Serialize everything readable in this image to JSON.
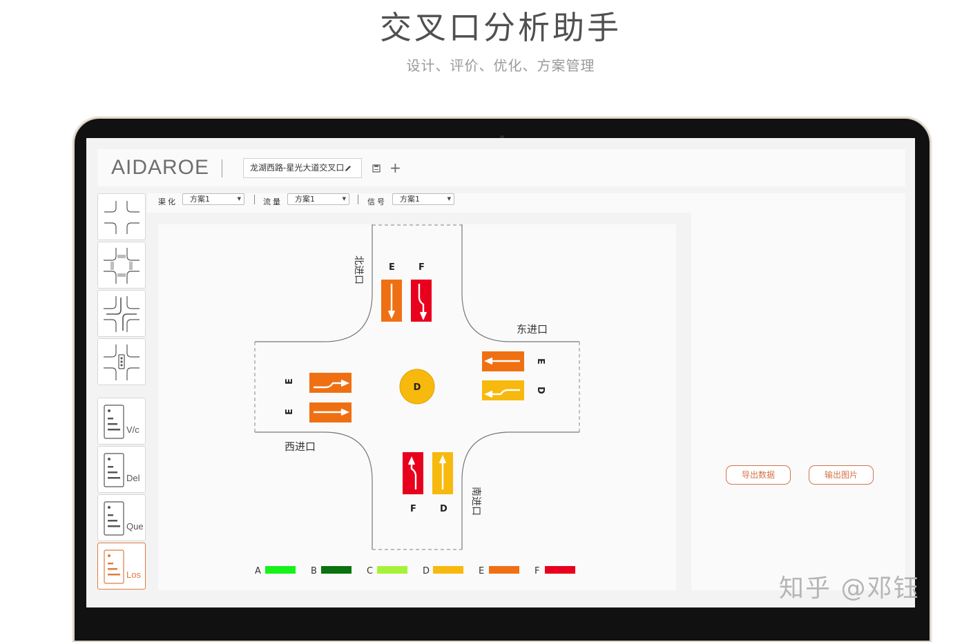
{
  "hero": {
    "title": "交叉口分析助手",
    "subtitle": "设计、评价、优化、方案管理"
  },
  "app": {
    "logo": "AIDAROE",
    "project_name": "龙湖西路-星光大道交叉口"
  },
  "scheme_bar": {
    "channelization": {
      "label": "渠化",
      "value": "方案1"
    },
    "volume": {
      "label": "流量",
      "value": "方案1"
    },
    "signal": {
      "label": "信号",
      "value": "方案1"
    }
  },
  "sidebar": {
    "tools": [
      {
        "icon": "intersection-icon"
      },
      {
        "icon": "crosswalk-icon"
      },
      {
        "icon": "turn-flows-icon"
      },
      {
        "icon": "traffic-signal-icon"
      }
    ],
    "eval": [
      {
        "label": "V/c"
      },
      {
        "label": "Del"
      },
      {
        "label": "Que"
      },
      {
        "label": "Los",
        "active": true
      }
    ]
  },
  "intersection": {
    "approaches": {
      "north": "北进口",
      "east": "东进口",
      "west": "西进口",
      "south": "南进口"
    },
    "center_los": "D",
    "north_lanes": [
      {
        "los": "E",
        "movement": "through",
        "color": "#ef7013"
      },
      {
        "los": "F",
        "movement": "left",
        "color": "#e8001d"
      }
    ],
    "east_lanes": [
      {
        "los": "E",
        "movement": "through",
        "color": "#ef7013"
      },
      {
        "los": "D",
        "movement": "left",
        "color": "#f7b90d"
      }
    ],
    "west_lanes": [
      {
        "los": "E",
        "movement": "left",
        "color": "#ef7013"
      },
      {
        "los": "E",
        "movement": "through",
        "color": "#ef7013"
      }
    ],
    "south_lanes": [
      {
        "los": "F",
        "movement": "left",
        "color": "#e8001d"
      },
      {
        "los": "D",
        "movement": "through",
        "color": "#f7b90d"
      }
    ],
    "legend": [
      {
        "label": "A",
        "color": "#16f21a"
      },
      {
        "label": "B",
        "color": "#0a720e"
      },
      {
        "label": "C",
        "color": "#a6f23a"
      },
      {
        "label": "D",
        "color": "#f7b90d"
      },
      {
        "label": "E",
        "color": "#ef7013"
      },
      {
        "label": "F",
        "color": "#e8001d"
      }
    ]
  },
  "actions": {
    "export_data": "导出数据",
    "export_image": "输出图片"
  },
  "watermark": "知乎 @邓钰"
}
